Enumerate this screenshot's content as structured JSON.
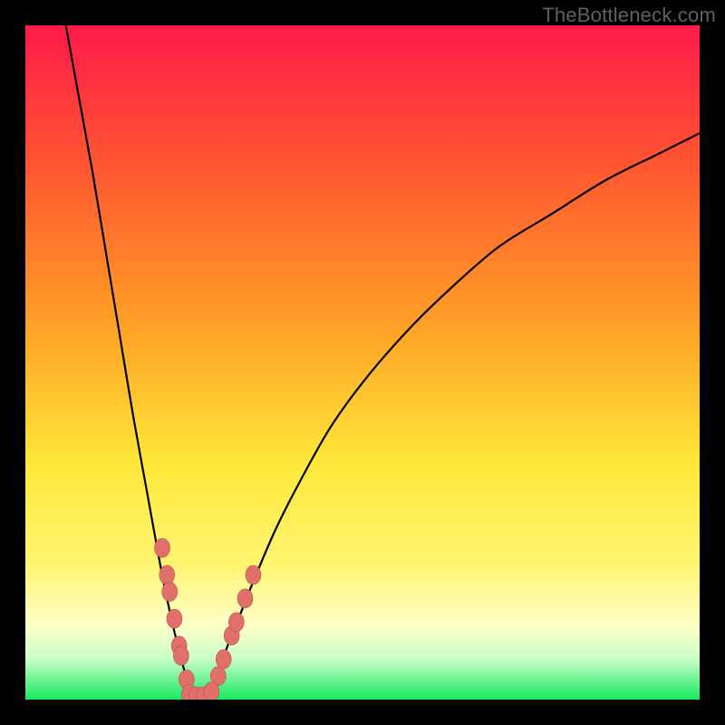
{
  "watermark": "TheBottleneck.com",
  "colors": {
    "frame": "#000000",
    "gradient_top": "#ff1a4a",
    "gradient_mid1": "#ff6a2a",
    "gradient_mid2": "#ffc226",
    "gradient_mid3": "#ffe83a",
    "gradient_pale": "#ffffa5",
    "gradient_bottom": "#18e860",
    "curve": "#000000",
    "dot_fill": "#e16f6a",
    "dot_stroke": "#b85550"
  },
  "chart_data": {
    "type": "line",
    "title": "",
    "xlabel": "",
    "ylabel": "",
    "xlim": [
      0,
      100
    ],
    "ylim": [
      0,
      100
    ],
    "series": [
      {
        "name": "left-branch",
        "x": [
          6,
          8,
          10,
          12,
          14,
          16,
          18,
          20,
          21,
          22,
          23,
          23.8,
          24.4,
          25
        ],
        "y": [
          100,
          89,
          78,
          66,
          54,
          42,
          31,
          20,
          15,
          10.5,
          6.5,
          3.5,
          1.5,
          0
        ]
      },
      {
        "name": "right-branch",
        "x": [
          27,
          28,
          29,
          30,
          32,
          34,
          37,
          40,
          45,
          50,
          56,
          62,
          70,
          78,
          86,
          94,
          100
        ],
        "y": [
          0,
          2,
          5,
          8,
          13,
          18,
          25,
          31,
          40,
          47,
          54,
          60,
          67,
          72,
          77,
          81,
          84
        ]
      }
    ],
    "dots_left": [
      {
        "x": 20.3,
        "y": 22.5
      },
      {
        "x": 21.0,
        "y": 18.5
      },
      {
        "x": 21.4,
        "y": 16.0
      },
      {
        "x": 22.1,
        "y": 12.0
      },
      {
        "x": 22.8,
        "y": 8.0
      },
      {
        "x": 23.1,
        "y": 6.5
      },
      {
        "x": 23.9,
        "y": 3.0
      }
    ],
    "dots_right": [
      {
        "x": 28.6,
        "y": 3.5
      },
      {
        "x": 29.4,
        "y": 6.0
      },
      {
        "x": 30.6,
        "y": 9.5
      },
      {
        "x": 31.3,
        "y": 11.5
      },
      {
        "x": 32.6,
        "y": 15.0
      },
      {
        "x": 33.8,
        "y": 18.5
      }
    ],
    "dots_bottom": [
      {
        "x": 24.3,
        "y": 0.8
      },
      {
        "x": 25.4,
        "y": 0.5
      },
      {
        "x": 26.5,
        "y": 0.5
      },
      {
        "x": 27.6,
        "y": 1.2
      }
    ]
  }
}
